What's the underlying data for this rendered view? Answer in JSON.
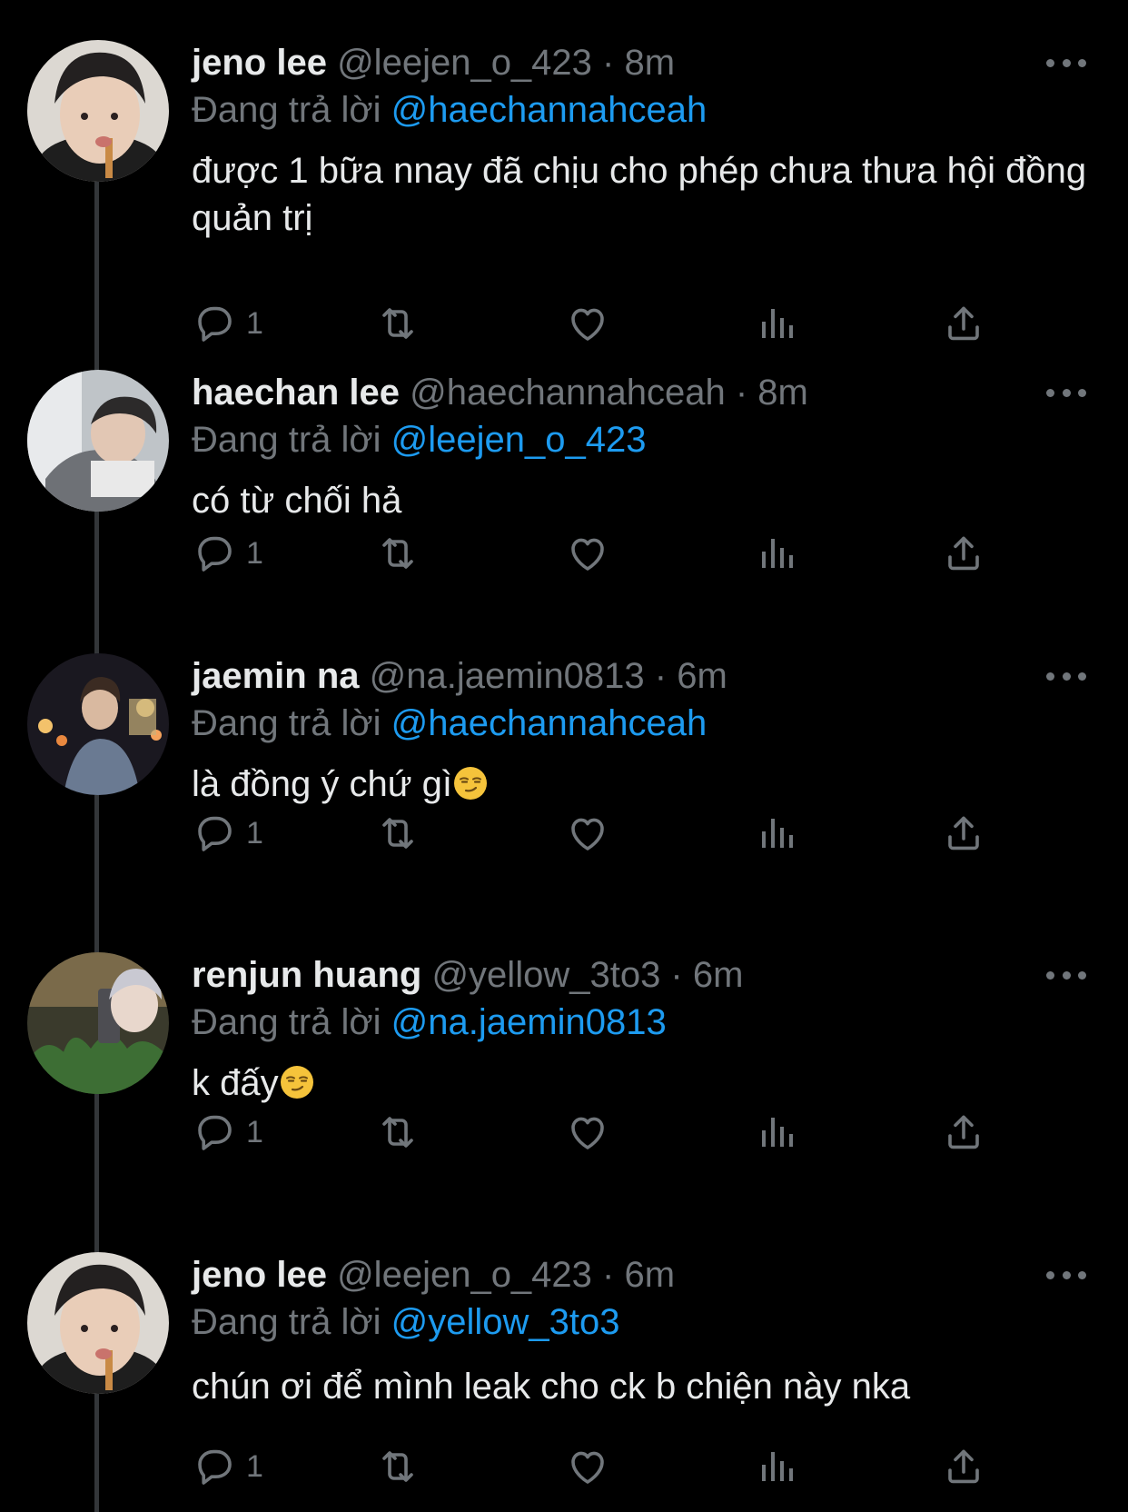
{
  "colors": {
    "background": "#000000",
    "name": "#e7e9ea",
    "muted": "#71767b",
    "link": "#1d9bf0",
    "thread_line": "#333639"
  },
  "icons": {
    "reply": "reply-icon",
    "retweet": "retweet-icon",
    "like": "like-icon",
    "views": "views-icon",
    "share": "share-icon",
    "more": "more-icon",
    "emoji": "smirking-face-emoji"
  },
  "tweets": [
    {
      "name": "jeno lee",
      "meta": "@leejen_o_423 · 8m",
      "reply_prefix": "Đang trả lời",
      "reply_handle": "@haechannahceah",
      "text": "được 1 bữa nnay đã chịu cho phép chưa thưa hội đồng quản trị",
      "reply_count": "1"
    },
    {
      "name": "haechan lee",
      "meta": "@haechannahceah · 8m",
      "reply_prefix": "Đang trả lời",
      "reply_handle": "@leejen_o_423",
      "text": "có từ chối hả",
      "reply_count": "1"
    },
    {
      "name": "jaemin na",
      "meta": "@na.jaemin0813 · 6m",
      "reply_prefix": "Đang trả lời",
      "reply_handle": "@haechannahceah",
      "text": "là đồng ý chứ gì",
      "reply_count": "1"
    },
    {
      "name": "renjun huang",
      "meta": "@yellow_3to3 · 6m",
      "reply_prefix": "Đang trả lời",
      "reply_handle": "@na.jaemin0813",
      "text": "k đấy",
      "reply_count": "1"
    },
    {
      "name": "jeno lee",
      "meta": "@leejen_o_423 · 6m",
      "reply_prefix": "Đang trả lời",
      "reply_handle": "@yellow_3to3",
      "text": "chún ơi để mình leak cho ck b chiện này nka",
      "reply_count": "1"
    }
  ]
}
